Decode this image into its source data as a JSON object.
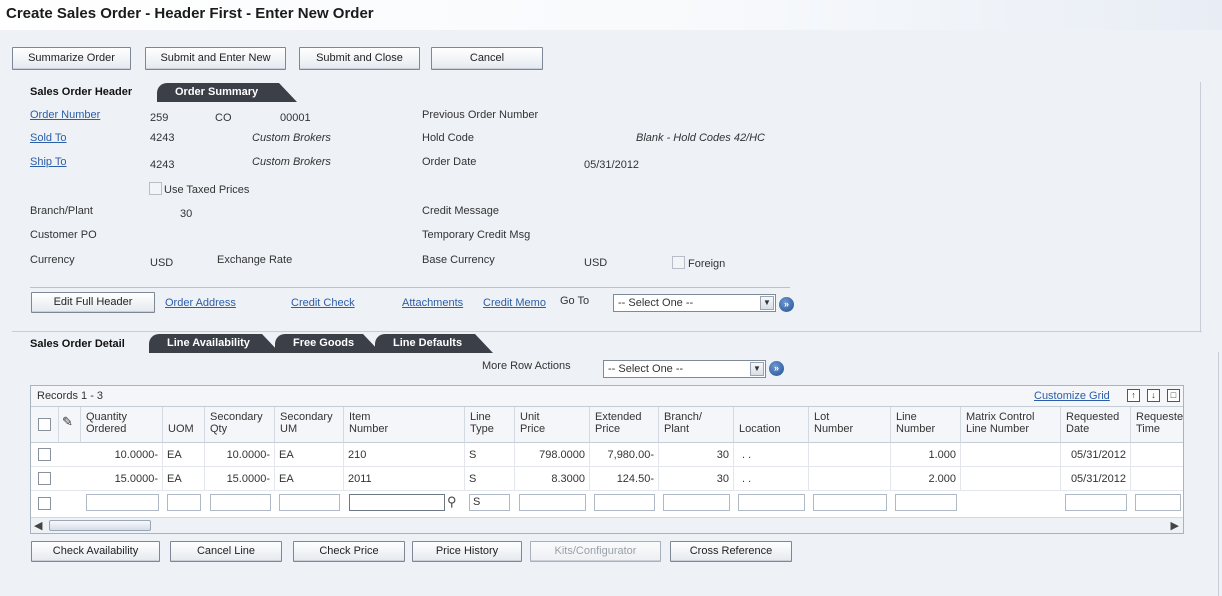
{
  "window": {
    "title": "Create Sales Order - Header First - Enter New Order"
  },
  "toolbar": {
    "summarize": "Summarize Order",
    "submit_new": "Submit and Enter New",
    "submit_close": "Submit and Close",
    "cancel": "Cancel"
  },
  "header": {
    "section_title": "Sales Order Header",
    "tab_summary": "Order Summary",
    "order_number_label": "Order Number",
    "order_number": "259",
    "order_type": "CO",
    "order_company": "00001",
    "sold_to_label": "Sold To",
    "sold_to": "4243",
    "sold_to_name": "Custom Brokers",
    "ship_to_label": "Ship To",
    "ship_to": "4243",
    "ship_to_name": "Custom Brokers",
    "use_taxed_prices": "Use Taxed Prices",
    "branch_label": "Branch/Plant",
    "branch": "30",
    "customer_po_label": "Customer PO",
    "currency_label": "Currency",
    "currency": "USD",
    "exchange_rate_label": "Exchange Rate",
    "prev_order_label": "Previous Order Number",
    "hold_code_label": "Hold Code",
    "hold_code_value": "Blank - Hold Codes 42/HC",
    "order_date_label": "Order Date",
    "order_date": "05/31/2012",
    "credit_msg_label": "Credit Message",
    "temp_credit_label": "Temporary Credit Msg",
    "base_currency_label": "Base Currency",
    "base_currency": "USD",
    "foreign_label": "Foreign"
  },
  "header_actions": {
    "edit_full": "Edit Full Header",
    "order_address": "Order Address",
    "credit_check": "Credit Check",
    "attachments": "Attachments",
    "credit_memo": "Credit Memo",
    "goto_label": "Go To",
    "goto_select": "-- Select One --"
  },
  "detail": {
    "section_title": "Sales Order Detail",
    "tab_availability": "Line Availability",
    "tab_free_goods": "Free Goods",
    "tab_defaults": "Line Defaults",
    "more_row_actions": "More Row Actions",
    "row_actions_select": "-- Select One --",
    "records": "Records 1 - 3",
    "customize_grid": "Customize Grid"
  },
  "grid": {
    "columns": {
      "qty1": "Quantity",
      "qty2": "Ordered",
      "uom": "UOM",
      "secqty1": "Secondary",
      "secqty2": "Qty",
      "secum1": "Secondary",
      "secum2": "UM",
      "item1": "Item",
      "item2": "Number",
      "ltype1": "Line",
      "ltype2": "Type",
      "uprice1": "Unit",
      "uprice2": "Price",
      "eprice1": "Extended",
      "eprice2": "Price",
      "branch1": "Branch/",
      "branch2": "Plant",
      "location": "Location",
      "lot1": "Lot",
      "lot2": "Number",
      "lnum1": "Line",
      "lnum2": "Number",
      "matrix1": "Matrix Control",
      "matrix2": "Line Number",
      "reqdate1": "Requested",
      "reqdate2": "Date",
      "reqtime1": "Requested",
      "reqtime2": "Time"
    },
    "rows": [
      {
        "qty": "10.0000-",
        "uom": "EA",
        "secqty": "10.0000-",
        "secum": "EA",
        "item": "210",
        "ltype": "S",
        "uprice": "798.0000",
        "eprice": "7,980.00-",
        "branch": "30",
        "location": ". .",
        "lnum": "1.000",
        "reqdate": "05/31/2012"
      },
      {
        "qty": "15.0000-",
        "uom": "EA",
        "secqty": "15.0000-",
        "secum": "EA",
        "item": "2011",
        "ltype": "S",
        "uprice": "8.3000",
        "eprice": "124.50-",
        "branch": "30",
        "location": ". .",
        "lnum": "2.000",
        "reqdate": "05/31/2012"
      }
    ],
    "new_row": {
      "ltype": "S"
    }
  },
  "bottom": {
    "check_availability": "Check Availability",
    "cancel_line": "Cancel Line",
    "check_price": "Check Price",
    "price_history": "Price History",
    "kits": "Kits/Configurator",
    "cross_reference": "Cross Reference"
  },
  "colors": {
    "accent_link": "#2b5ea8",
    "tab_bg": "#3a3f48",
    "page_bg": "#eef1f6"
  }
}
